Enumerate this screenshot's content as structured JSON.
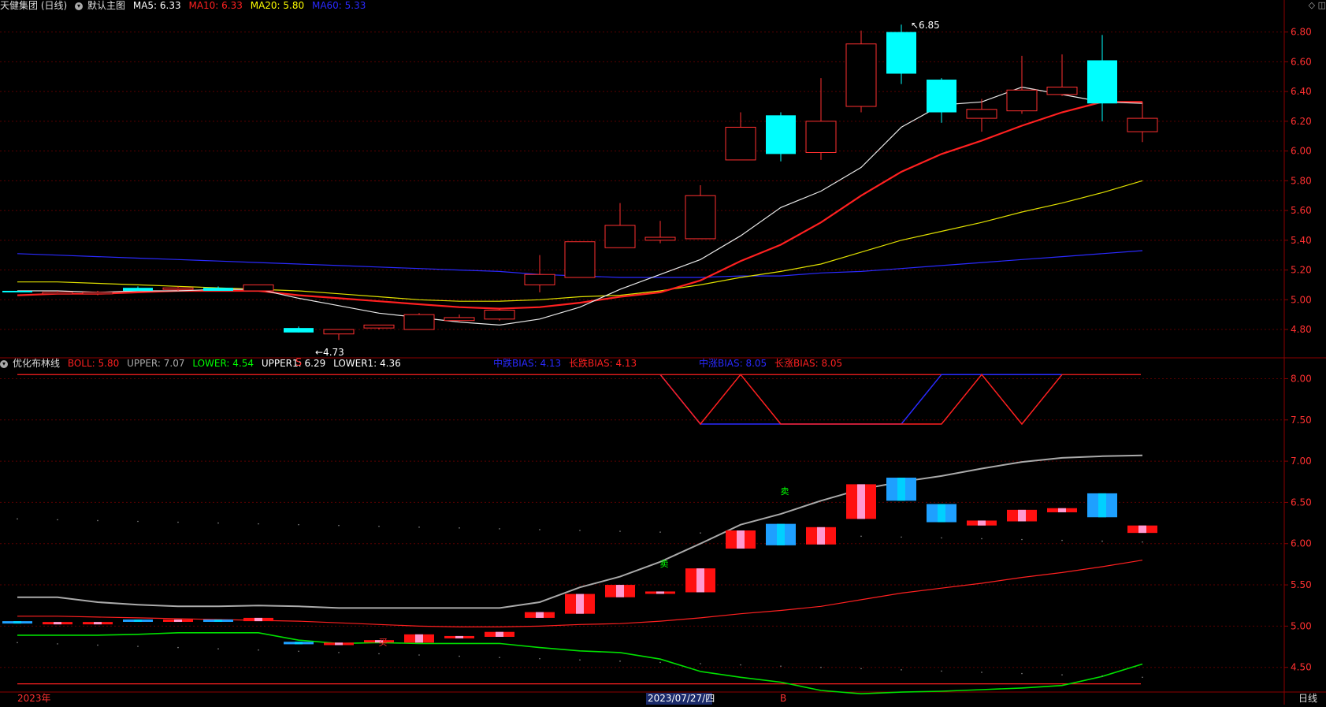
{
  "main": {
    "title": "天健集团 (日线)",
    "template": "默认主图",
    "ma": [
      {
        "label": "MA5: 6.33",
        "color": "#ffffff"
      },
      {
        "label": "MA10: 6.33",
        "color": "#ff2020"
      },
      {
        "label": "MA20: 5.80",
        "color": "#ffff00"
      },
      {
        "label": "MA60: 5.33",
        "color": "#2a2aff"
      }
    ],
    "high_label": "6.85",
    "low_label": "4.73",
    "s_marker": "S",
    "y_ticks": [
      "6.80",
      "6.60",
      "6.40",
      "6.20",
      "6.00",
      "5.80",
      "5.60",
      "5.40",
      "5.20",
      "5.00",
      "4.80"
    ]
  },
  "sub": {
    "title": "优化布林线",
    "params": [
      {
        "label": "BOLL: 5.80",
        "color": "#ff2020"
      },
      {
        "label": "UPPER: 7.07",
        "color": "#aaaaaa"
      },
      {
        "label": "LOWER: 4.54",
        "color": "#00ff00"
      },
      {
        "label": "UPPER1: 6.29",
        "color": "#ffffff"
      },
      {
        "label": "LOWER1: 4.36",
        "color": "#ffffff"
      }
    ],
    "bias": [
      {
        "label": "中跌BIAS: 4.13",
        "color": "#2a2aff"
      },
      {
        "label": "长跌BIAS: 4.13",
        "color": "#ff2020"
      },
      {
        "label": "中涨BIAS: 8.05",
        "color": "#2a2aff"
      },
      {
        "label": "长涨BIAS: 8.05",
        "color": "#ff2020"
      }
    ],
    "y_ticks": [
      "8.00",
      "7.50",
      "7.00",
      "6.50",
      "6.00",
      "5.50",
      "5.00",
      "4.50"
    ],
    "markers": [
      "卖",
      "卖",
      "买"
    ]
  },
  "footer": {
    "year_label": "2023年",
    "cursor_date": "2023/07/27/四",
    "b_marker": "B",
    "period": "日线"
  },
  "chart_data": {
    "type": "candlestick",
    "ohlc": [
      [
        5.06,
        5.06,
        5.05,
        5.05
      ],
      [
        5.05,
        5.06,
        5.04,
        5.05
      ],
      [
        5.05,
        5.06,
        5.03,
        5.05
      ],
      [
        5.08,
        5.09,
        5.06,
        5.06
      ],
      [
        5.08,
        5.09,
        5.06,
        5.08
      ],
      [
        5.08,
        5.09,
        5.06,
        5.06
      ],
      [
        5.06,
        5.1,
        5.06,
        5.1
      ],
      [
        4.81,
        4.82,
        4.78,
        4.78
      ],
      [
        4.77,
        4.8,
        4.73,
        4.8
      ],
      [
        4.81,
        4.83,
        4.8,
        4.83
      ],
      [
        4.8,
        4.91,
        4.8,
        4.9
      ],
      [
        4.86,
        4.9,
        4.85,
        4.88
      ],
      [
        4.87,
        4.94,
        4.86,
        4.93
      ],
      [
        5.1,
        5.3,
        5.05,
        5.17
      ],
      [
        5.15,
        5.39,
        5.15,
        5.39
      ],
      [
        5.35,
        5.65,
        5.35,
        5.5
      ],
      [
        5.4,
        5.53,
        5.38,
        5.42
      ],
      [
        5.41,
        5.77,
        5.41,
        5.7
      ],
      [
        5.94,
        6.26,
        5.94,
        6.16
      ],
      [
        6.24,
        6.26,
        5.93,
        5.98
      ],
      [
        5.99,
        6.49,
        5.94,
        6.2
      ],
      [
        6.3,
        6.81,
        6.26,
        6.72
      ],
      [
        6.8,
        6.85,
        6.45,
        6.52
      ],
      [
        6.48,
        6.49,
        6.19,
        6.26
      ],
      [
        6.22,
        6.35,
        6.13,
        6.28
      ],
      [
        6.27,
        6.64,
        6.25,
        6.41
      ],
      [
        6.38,
        6.65,
        6.37,
        6.43
      ],
      [
        6.61,
        6.78,
        6.2,
        6.32
      ],
      [
        6.13,
        6.33,
        6.06,
        6.22
      ]
    ],
    "ma5": [
      5.06,
      5.06,
      5.05,
      5.06,
      5.06,
      5.07,
      5.07,
      5.01,
      4.96,
      4.91,
      4.88,
      4.85,
      4.83,
      4.87,
      4.95,
      5.07,
      5.17,
      5.27,
      5.43,
      5.62,
      5.73,
      5.89,
      6.16,
      6.31,
      6.33,
      6.43,
      6.38,
      6.33,
      6.32
    ],
    "ma10": [
      5.03,
      5.04,
      5.04,
      5.05,
      5.06,
      5.06,
      5.06,
      5.03,
      5.01,
      4.99,
      4.97,
      4.95,
      4.94,
      4.95,
      4.98,
      5.02,
      5.05,
      5.13,
      5.26,
      5.37,
      5.52,
      5.7,
      5.86,
      5.98,
      6.07,
      6.17,
      6.26,
      6.33,
      6.33
    ],
    "ma20": [
      5.12,
      5.12,
      5.11,
      5.1,
      5.09,
      5.08,
      5.07,
      5.06,
      5.04,
      5.02,
      5.0,
      4.99,
      4.99,
      5.0,
      5.02,
      5.03,
      5.06,
      5.1,
      5.15,
      5.19,
      5.24,
      5.32,
      5.4,
      5.46,
      5.52,
      5.59,
      5.65,
      5.72,
      5.8
    ],
    "ma60": [
      5.31,
      5.3,
      5.29,
      5.28,
      5.27,
      5.26,
      5.25,
      5.24,
      5.23,
      5.22,
      5.21,
      5.2,
      5.19,
      5.17,
      5.16,
      5.15,
      5.15,
      5.15,
      5.16,
      5.16,
      5.18,
      5.19,
      5.21,
      5.23,
      5.25,
      5.27,
      5.29,
      5.31,
      5.33
    ],
    "boll_mid": [
      5.12,
      5.12,
      5.11,
      5.1,
      5.09,
      5.08,
      5.07,
      5.06,
      5.04,
      5.02,
      5.0,
      4.99,
      4.99,
      5.0,
      5.02,
      5.03,
      5.06,
      5.1,
      5.15,
      5.19,
      5.24,
      5.32,
      5.4,
      5.46,
      5.52,
      5.59,
      5.65,
      5.72,
      5.8
    ],
    "boll_upper": [
      5.35,
      5.35,
      5.29,
      5.26,
      5.24,
      5.24,
      5.25,
      5.24,
      5.22,
      5.22,
      5.22,
      5.22,
      5.22,
      5.29,
      5.47,
      5.6,
      5.78,
      6.0,
      6.23,
      6.36,
      6.52,
      6.66,
      6.75,
      6.82,
      6.91,
      6.99,
      7.04,
      7.06,
      7.07
    ],
    "boll_lower": [
      4.89,
      4.89,
      4.89,
      4.9,
      4.92,
      4.92,
      4.92,
      4.83,
      4.79,
      4.8,
      4.79,
      4.79,
      4.79,
      4.74,
      4.7,
      4.68,
      4.6,
      4.45,
      4.38,
      4.32,
      4.22,
      4.18,
      4.2,
      4.21,
      4.23,
      4.25,
      4.28,
      4.39,
      4.54
    ],
    "mid_bias_up": [
      null,
      null,
      null,
      null,
      null,
      null,
      null,
      null,
      null,
      null,
      null,
      null,
      null,
      null,
      null,
      null,
      8.05,
      7.45,
      7.45,
      7.45,
      7.45,
      7.45,
      7.45,
      8.05,
      8.05,
      8.05,
      8.05,
      null,
      null
    ],
    "long_bias_up": [
      null,
      null,
      null,
      null,
      null,
      null,
      null,
      null,
      null,
      null,
      null,
      null,
      null,
      null,
      null,
      null,
      8.05,
      7.45,
      8.05,
      7.45,
      7.45,
      7.45,
      7.45,
      7.45,
      8.05,
      7.45,
      8.05,
      null,
      null
    ],
    "main_ylim": [
      4.62,
      6.92
    ],
    "sub_ylim": [
      4.22,
      8.1
    ]
  }
}
